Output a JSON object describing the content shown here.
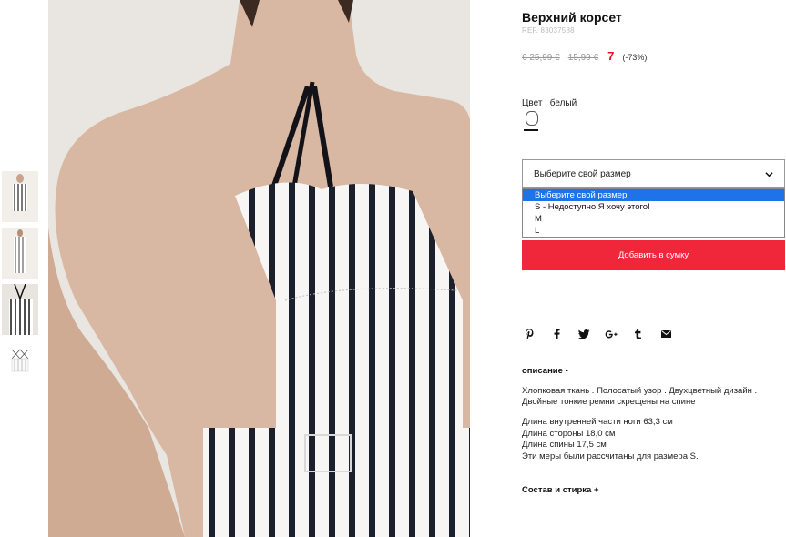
{
  "product": {
    "title": "Верхний корсет",
    "ref": "REF. 83037588",
    "price_old_1": "€ 25,99 €",
    "price_old_2": "15,99 €",
    "price_now": "7",
    "discount": "(-73%)"
  },
  "color": {
    "label": "Цвет : белый",
    "swatch_color": "#ffffff"
  },
  "size_select": {
    "value": "Выберите свой размер",
    "options": [
      {
        "label": "Выберите свой размер",
        "selected": true
      },
      {
        "label": "S - Недоступно Я хочу этого!",
        "selected": false
      },
      {
        "label": "M",
        "selected": false
      },
      {
        "label": "L",
        "selected": false
      }
    ]
  },
  "add_to_bag": "Добавить в сумку",
  "social_icons": [
    "pinterest-icon",
    "facebook-icon",
    "twitter-icon",
    "google-plus-icon",
    "tumblr-icon",
    "email-icon"
  ],
  "social_glyphs": {
    "pinterest": "𝓅",
    "facebook": "f",
    "twitter": "🐦",
    "google_plus": "G+",
    "tumblr": "t",
    "email": "✉"
  },
  "description": {
    "heading": "описание -",
    "line1": "Хлопковая ткань . Полосатый узор . Двухцветный дизайн .",
    "line2": "Двойные тонкие ремни скрещены на спине .",
    "m1": "Длина внутренней части ноги 63,3 см",
    "m2": "Длина стороны 18,0 см",
    "m3": "Длина спины 17,5 см",
    "m4": "Эти меры были рассчитаны для размера S."
  },
  "composition_heading": "Состав и стирка +",
  "colors": {
    "accent_red": "#f0263a",
    "price_red": "#e0131e",
    "select_blue": "#1e73e8"
  }
}
